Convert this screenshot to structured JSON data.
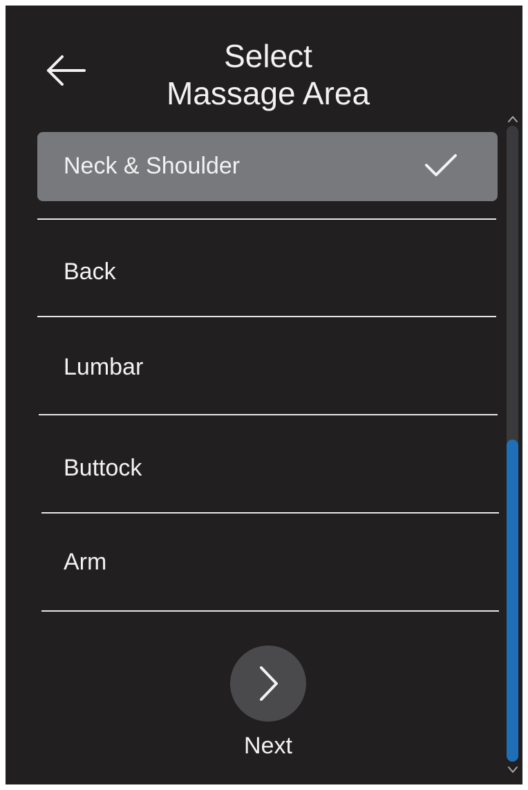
{
  "header": {
    "title_line1": "Select",
    "title_line2": "Massage Area",
    "back_icon": "arrow-left-icon"
  },
  "areas": {
    "items": [
      {
        "label": "Neck & Shoulder",
        "selected": true
      },
      {
        "label": "Back",
        "selected": false
      },
      {
        "label": "Lumbar",
        "selected": false
      },
      {
        "label": "Buttock",
        "selected": false
      },
      {
        "label": "Arm",
        "selected": false
      }
    ],
    "selected_icon": "checkmark-icon"
  },
  "footer": {
    "next_label": "Next",
    "next_icon": "chevron-right-icon"
  },
  "colors": {
    "background": "#221f20",
    "selected_row": "#77797c",
    "scroll_thumb": "#1f6fb8",
    "scroll_track": "#3a3a3c",
    "next_button": "#4a4a4c",
    "text": "#f2f2f2"
  }
}
